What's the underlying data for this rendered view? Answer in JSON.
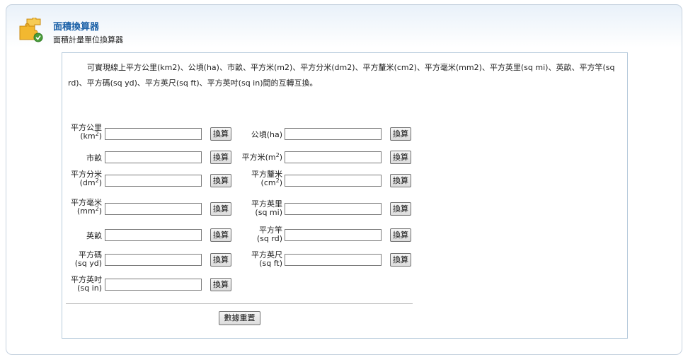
{
  "header": {
    "title": "面積換算器",
    "subtitle": "面積計量單位換算器"
  },
  "description": "可實現線上平方公里(km2)、公頃(ha)、市畝、平方米(m2)、平方分米(dm2)、平方釐米(cm2)、平方毫米(mm2)、平方英里(sq mi)、英畝、平方竿(sq rd)、平方碼(sq yd)、平方英尺(sq ft)、平方英吋(sq in)間的互轉互換。",
  "convert_label": "換算",
  "reset_label": "數據重置",
  "units": [
    {
      "line1": "平方公里",
      "line2": "(km",
      "sup": "2",
      "tail": ")",
      "value": ""
    },
    {
      "line1": "",
      "line2": "公頃(ha)",
      "sup": "",
      "tail": "",
      "value": ""
    },
    {
      "line1": "",
      "line2": "市畝",
      "sup": "",
      "tail": "",
      "value": ""
    },
    {
      "line1": "",
      "line2": "平方米(m",
      "sup": "2",
      "tail": ")",
      "value": ""
    },
    {
      "line1": "平方分米",
      "line2": "(dm",
      "sup": "2",
      "tail": ")",
      "value": ""
    },
    {
      "line1": "平方釐米",
      "line2": "(cm",
      "sup": "2",
      "tail": ")",
      "value": ""
    },
    {
      "line1": "平方毫米",
      "line2": "(mm",
      "sup": "2",
      "tail": ")",
      "value": ""
    },
    {
      "line1": "平方英里",
      "line2": "(sq mi)",
      "sup": "",
      "tail": "",
      "value": ""
    },
    {
      "line1": "",
      "line2": "英畝",
      "sup": "",
      "tail": "",
      "value": ""
    },
    {
      "line1": "平方竿",
      "line2": "(sq rd)",
      "sup": "",
      "tail": "",
      "value": ""
    },
    {
      "line1": "平方碼",
      "line2": "(sq yd)",
      "sup": "",
      "tail": "",
      "value": ""
    },
    {
      "line1": "平方英尺",
      "line2": "(sq ft)",
      "sup": "",
      "tail": "",
      "value": ""
    },
    {
      "line1": "平方英吋",
      "line2": "(sq in)",
      "sup": "",
      "tail": "",
      "value": ""
    }
  ]
}
